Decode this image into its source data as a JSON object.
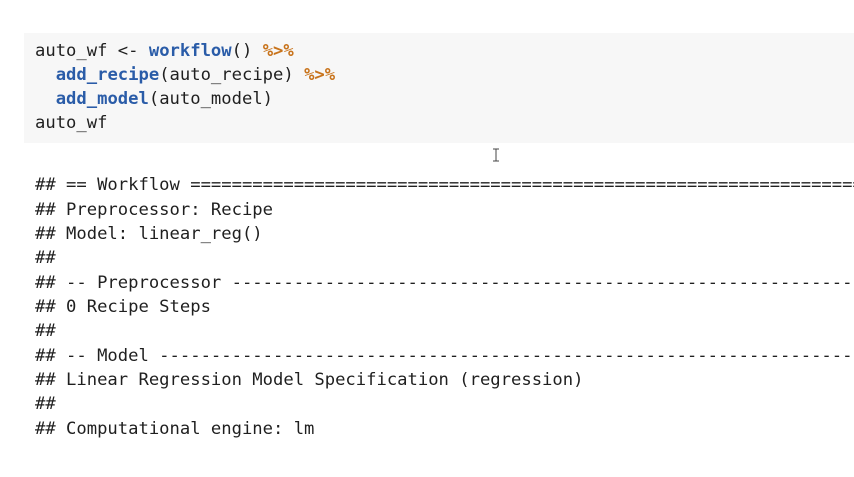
{
  "code": {
    "line1": {
      "var": "auto_wf",
      "assign": " <- ",
      "fn": "workflow",
      "call": "()",
      "pipe": " %>%"
    },
    "line2": {
      "fn": "add_recipe",
      "args": "(auto_recipe)",
      "pipe": " %>%"
    },
    "line3": {
      "fn": "add_model",
      "args": "(auto_model)"
    },
    "line4": {
      "var": "auto_wf"
    }
  },
  "output": [
    "## == Workflow ================================================================================",
    "## Preprocessor: Recipe",
    "## Model: linear_reg()",
    "##",
    "## -- Preprocessor --------------------------------------------------------------------------",
    "## 0 Recipe Steps",
    "##",
    "## -- Model ---------------------------------------------------------------------------------",
    "## Linear Regression Model Specification (regression)",
    "##",
    "## Computational engine: lm"
  ],
  "colors": {
    "function": "#2a5ca8",
    "operator": "#c8731b",
    "code_background": "#f7f7f7",
    "text": "#1f1f1f"
  },
  "cursor": {
    "icon": "ibeam-cursor-icon"
  }
}
